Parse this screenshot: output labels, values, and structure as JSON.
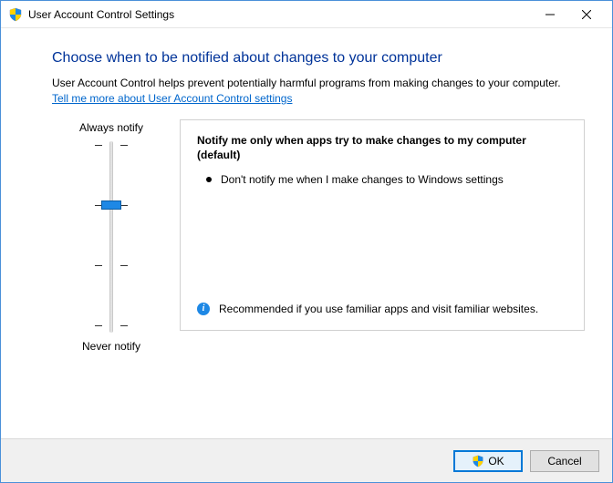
{
  "window": {
    "title": "User Account Control Settings"
  },
  "heading": "Choose when to be notified about changes to your computer",
  "subtext": "User Account Control helps prevent potentially harmful programs from making changes to your computer.",
  "help_link": "Tell me more about User Account Control settings",
  "slider": {
    "top_label": "Always notify",
    "bottom_label": "Never notify",
    "levels": 4,
    "current_level_from_top": 1
  },
  "detail": {
    "title": "Notify me only when apps try to make changes to my computer (default)",
    "bullet": "Don't notify me when I make changes to Windows settings",
    "recommendation": "Recommended if you use familiar apps and visit familiar websites."
  },
  "buttons": {
    "ok": "OK",
    "cancel": "Cancel"
  }
}
